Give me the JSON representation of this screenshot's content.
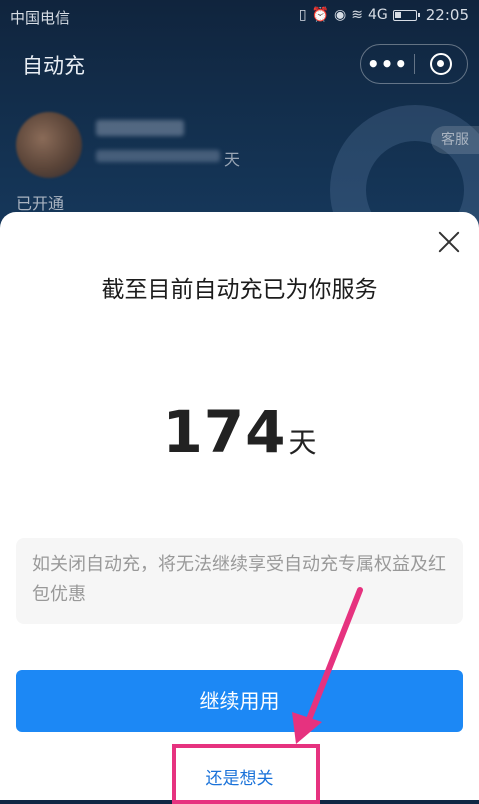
{
  "status_bar": {
    "carrier": "中国电信",
    "network": "4G",
    "time": "22:05"
  },
  "background_page": {
    "title": "自动充",
    "day_unit": "天",
    "customer_service": "客服",
    "status_text": "已开通"
  },
  "capsule": {
    "more_label": "•••"
  },
  "sheet": {
    "heading": "截至目前自动充已为你服务",
    "days_value": "174",
    "days_unit": "天",
    "notice": "如关闭自动充，将无法继续享受自动充专属权益及红包优惠",
    "continue_label": "继续用用",
    "still_close_label": "还是想关"
  },
  "colors": {
    "primary": "#1c88f5",
    "link": "#1a72d9",
    "annotation": "#e6327f"
  }
}
